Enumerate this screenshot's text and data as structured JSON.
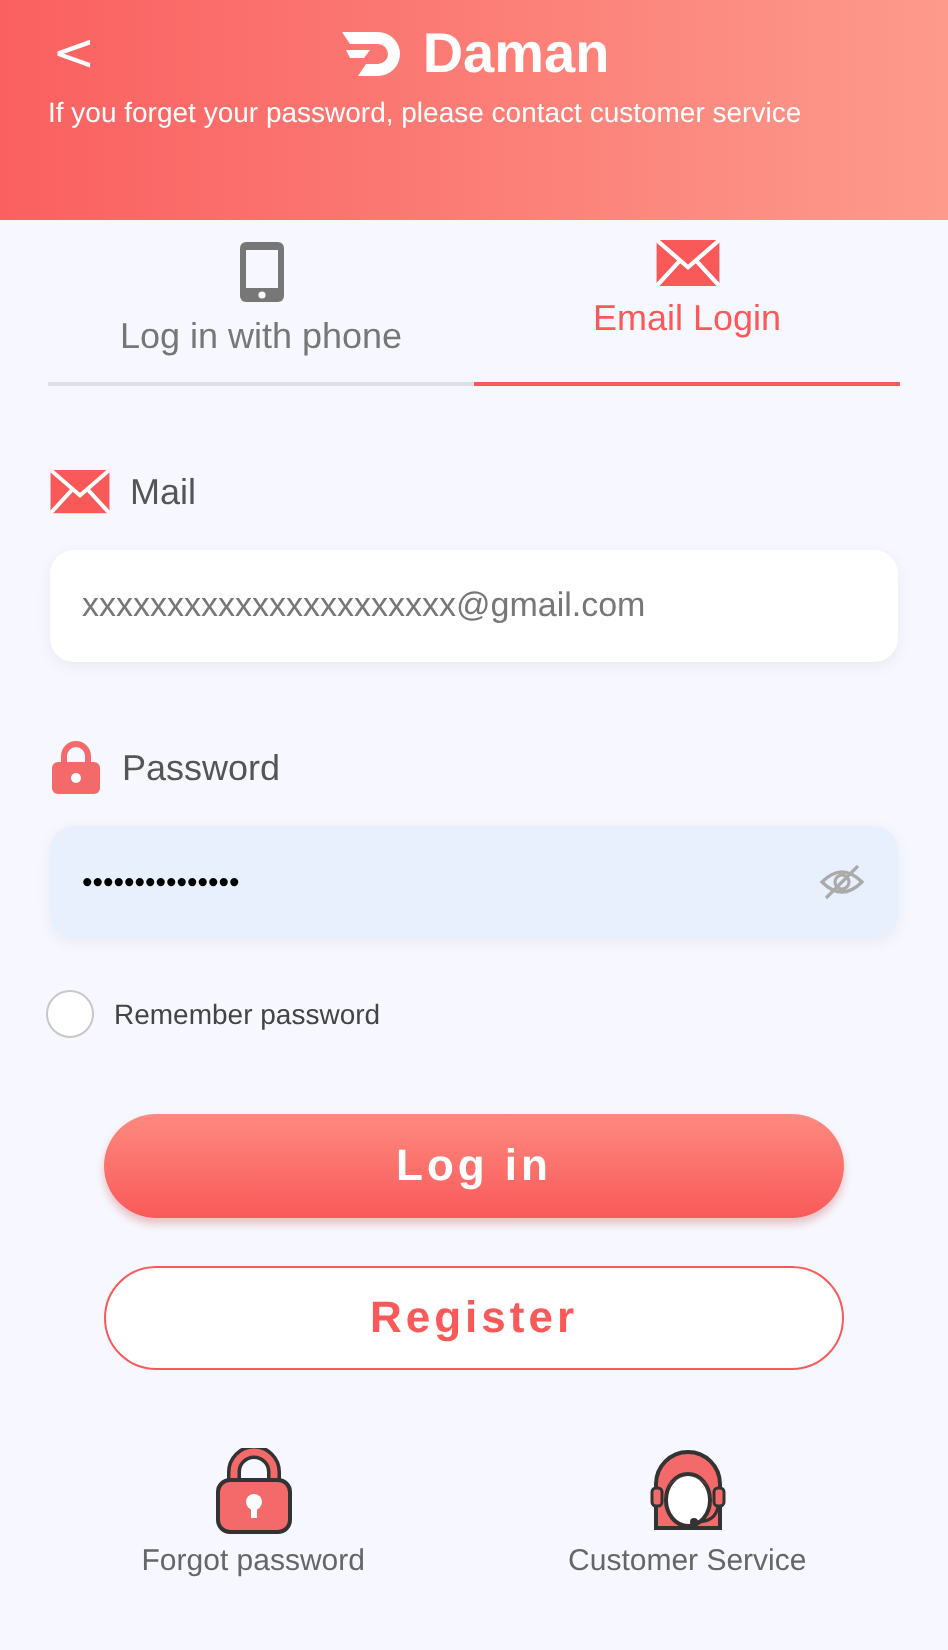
{
  "header": {
    "back": "<",
    "logo": "Daman",
    "notice": "If you forget your password, please contact customer service"
  },
  "tabs": [
    {
      "label": "Log in with phone",
      "kind": "phone",
      "selected": false
    },
    {
      "label": "Email Login",
      "kind": "mail",
      "selected": true
    }
  ],
  "mail": {
    "label": "Mail",
    "value": "xxxxxxxxxxxxxxxxxxxxxx@gmail.com"
  },
  "password": {
    "label": "Password",
    "value": "•••••••••••••••"
  },
  "remember": {
    "label": "Remember password",
    "checked": false
  },
  "buttons": [
    {
      "label": "Log in",
      "kind": "primary"
    },
    {
      "label": "Register",
      "kind": "outline"
    }
  ],
  "links": [
    {
      "label": "Forgot password",
      "kind": "lock"
    },
    {
      "label": "Customer Service",
      "kind": "agent"
    }
  ]
}
